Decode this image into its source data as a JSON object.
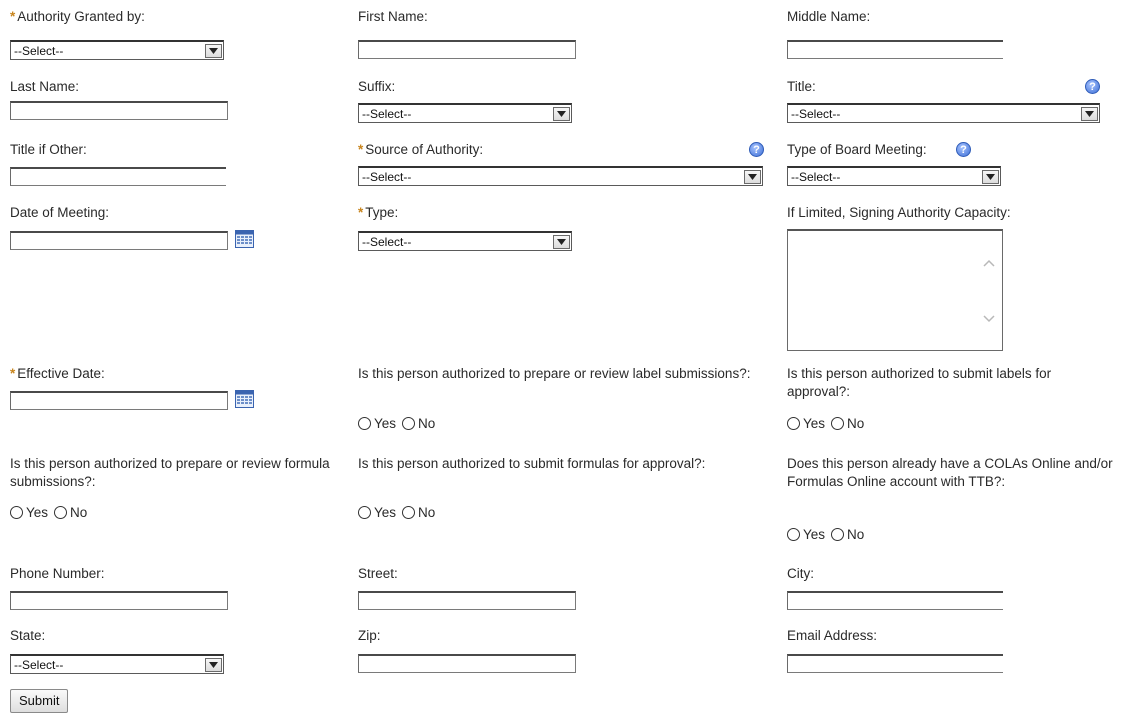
{
  "required_mark": "*",
  "select_default": "--Select--",
  "help_glyph": "?",
  "radio": {
    "yes": "Yes",
    "no": "No"
  },
  "labels": {
    "authority_granted_by": "Authority Granted by:",
    "first_name": "First Name:",
    "middle_name": "Middle Name:",
    "last_name": "Last Name:",
    "suffix": "Suffix:",
    "title": "Title:",
    "title_if_other": "Title if Other:",
    "source_of_authority": "Source of Authority:",
    "type_of_board_meeting": "Type of Board Meeting:",
    "date_of_meeting": "Date of Meeting:",
    "type": "Type:",
    "signing_authority_capacity": "If Limited, Signing Authority Capacity:",
    "effective_date": "Effective Date:",
    "prepare_label": "Is this person authorized to prepare or review label submissions?:",
    "submit_labels": "Is this person authorized to submit labels for approval?:",
    "prepare_formula": "Is this person authorized to prepare or review formula submissions?:",
    "submit_formulas": "Is this person authorized to submit formulas for approval?:",
    "cola_account": "Does this person already have a COLAs Online and/or Formulas Online account with TTB?:",
    "phone": "Phone Number:",
    "street": "Street:",
    "city": "City:",
    "state": "State:",
    "zip": "Zip:",
    "email": "Email Address:"
  },
  "submit_label": "Submit",
  "icons": {
    "help": "help-icon",
    "calendar": "calendar-icon",
    "dropdown": "chevron-down-icon"
  },
  "colors": {
    "required": "#c8851e",
    "help": "#3d6fd6"
  }
}
